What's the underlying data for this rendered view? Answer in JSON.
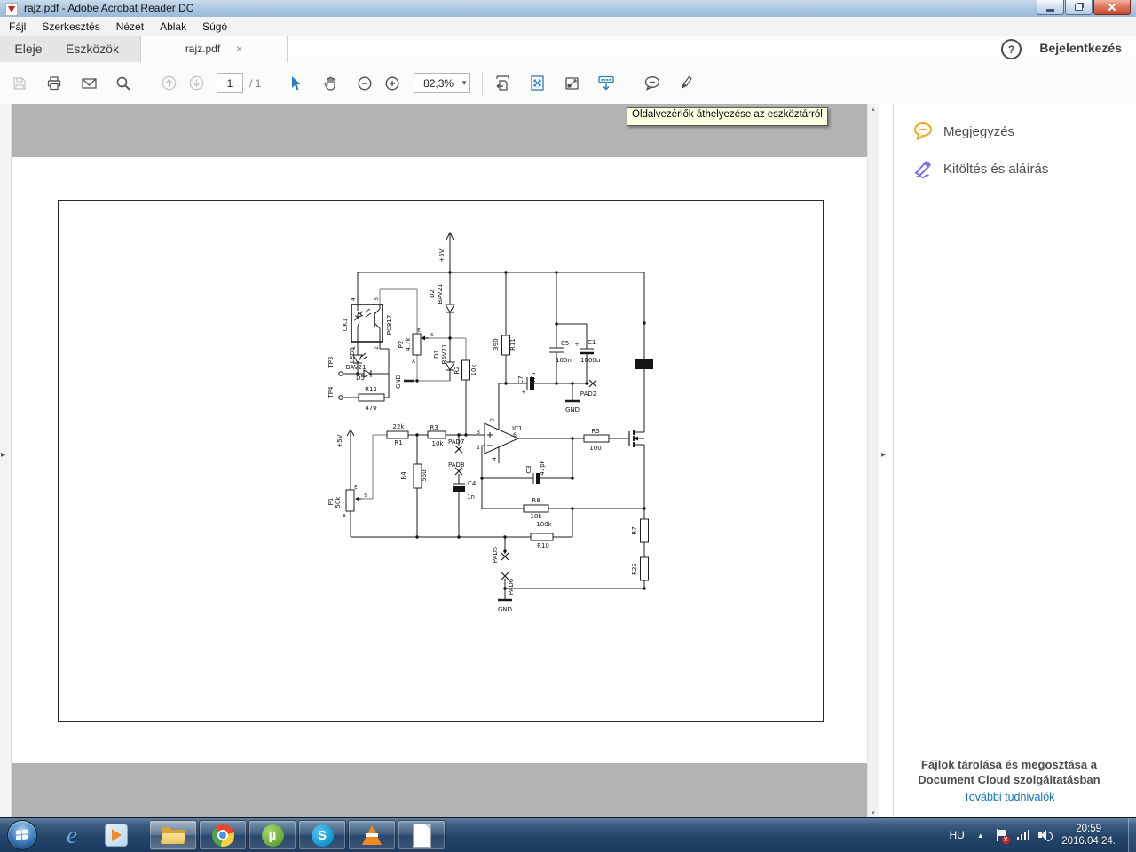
{
  "window": {
    "title": "rajz.pdf - Adobe Acrobat Reader DC"
  },
  "menu": {
    "items": [
      "Fájl",
      "Szerkesztés",
      "Nézet",
      "Ablak",
      "Súgó"
    ]
  },
  "tabs": {
    "home": "Eleje",
    "tools": "Eszközök",
    "document": "rajz.pdf",
    "sign_in": "Bejelentkezés"
  },
  "toolbar": {
    "page_current": "1",
    "page_total": "/ 1",
    "zoom_level": "82,3%",
    "tooltip": "Oldalvezérlők áthelyezése az eszköztárról"
  },
  "panel": {
    "comment": "Megjegyzés",
    "fill_sign": "Kitöltés és aláírás",
    "promo": "Fájlok tárolása és megosztása a Document Cloud szolgáltatásban",
    "promo_link": "További tudnivalók"
  },
  "taskbar": {
    "language": "HU",
    "time": "20:59",
    "date": "2016.04.24."
  },
  "icons": {
    "help": "?",
    "close_tab": "×",
    "caret_down": "▾",
    "panel_arrow": "▸",
    "scroll_up": "▴",
    "scroll_down": "▾",
    "tray_chevron": "▲",
    "ie": "e",
    "utorrent": "µ",
    "skype": "S",
    "flag_error": "✕"
  },
  "colors": {
    "accent_blue": "#2a7cc2",
    "tooltip_bg": "#ffffe1",
    "canvas_gray": "#b3b3b4",
    "taskbar_blue": "#24446a",
    "link_blue": "#1272c3",
    "comment_yellow": "#f0a828",
    "sign_purple": "#7b72e9"
  },
  "sch": {
    "vcc": "+5V",
    "vcc2": "+5V",
    "ok1": "OK1",
    "ok1_part": "PC817",
    "okpin4": "4",
    "okpin3": "3",
    "okpin1": "1",
    "okpin2": "2",
    "d2": "D2",
    "d2_val": "BAV21",
    "d1": "D1",
    "d1_val": "BAV21",
    "d5": "D5",
    "d5_val": "BAV21",
    "led1": "LED1",
    "tp3": "TP3",
    "tp4": "TP4",
    "r12": "R12",
    "r12_val": "470",
    "p2": "P2",
    "p2_val": "4.7k",
    "p1": "P1",
    "p1_val": "50k",
    "e": "E",
    "s": "S",
    "a": "A",
    "gnd": "GND",
    "r2": "R2",
    "r2_val": "10k",
    "r11": "R11",
    "r11_val": "390",
    "c5": "C5",
    "c5_val": "100n",
    "c1": "C1",
    "c1_val": "1000u",
    "c7": "C7",
    "c7_val": "47u",
    "plus": "+",
    "pad2": "PAD2",
    "pad5": "PAD5",
    "pad6": "PAD6",
    "pad7": "PAD7",
    "pad8": "PAD8",
    "r1": "R1",
    "r1_val": "22k",
    "r3": "R3",
    "r3_val": "10k",
    "r4": "R4",
    "r4_val": "560",
    "ic1": "IC1",
    "pin3": "3",
    "pin2": "2",
    "pin7": "7",
    "pin6": "6",
    "pin4": "4",
    "r5": "R5",
    "r5_val": "100",
    "c3": "C3",
    "c3_val": "47pF",
    "c4": "C4",
    "c4_val": "1n",
    "r8": "R8",
    "r8_val": "10k",
    "r10": "R10",
    "r10_val": "100k",
    "r7": "R7",
    "r23": "R23"
  }
}
